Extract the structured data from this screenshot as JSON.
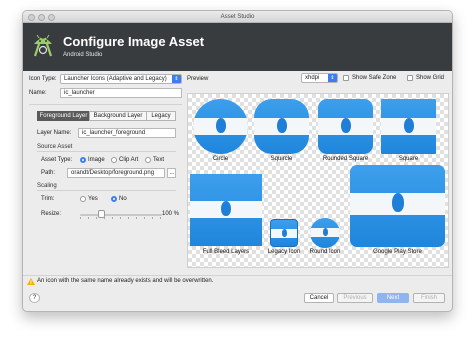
{
  "window": {
    "title": "Asset Studio"
  },
  "header": {
    "title": "Configure Image Asset",
    "subtitle": "Android Studio"
  },
  "form": {
    "icon_type_label": "Icon Type:",
    "icon_type_value": "Launcher Icons (Adaptive and Legacy)",
    "name_label": "Name:",
    "name_value": "ic_launcher",
    "tabs": [
      "Foreground Layer",
      "Background Layer",
      "Legacy"
    ],
    "active_tab": "Foreground Layer",
    "layer_name_label": "Layer Name:",
    "layer_name_value": "ic_launcher_foreground",
    "source_asset_title": "Source Asset",
    "asset_type_label": "Asset Type:",
    "asset_type_options": [
      "Image",
      "Clip Art",
      "Text"
    ],
    "asset_type_selected": "Image",
    "path_label": "Path:",
    "path_value": "orandt/Desktop/foreground.png",
    "path_browse": "...",
    "scaling_title": "Scaling",
    "trim_label": "Trim:",
    "trim_options": [
      "Yes",
      "No"
    ],
    "trim_selected": "No",
    "resize_label": "Resize:",
    "resize_value": "100 %",
    "resize_percent": 100
  },
  "preview": {
    "label": "Preview",
    "density": "xhdpi",
    "show_safe_zone_label": "Show Safe Zone",
    "show_safe_zone": false,
    "show_grid_label": "Show Grid",
    "show_grid": false,
    "icons": [
      "Circle",
      "Squircle",
      "Rounded Square",
      "Square",
      "Full Bleed Layers",
      "Legacy Icon",
      "Round Icon",
      "Google Play Store"
    ]
  },
  "warning": {
    "icon": "warning-icon",
    "text": "An icon with the same name already exists and will be overwritten."
  },
  "buttons": {
    "help": "?",
    "cancel": "Cancel",
    "previous": "Previous",
    "next": "Next",
    "finish": "Finish"
  },
  "colors": {
    "header_bg": "#383c3f",
    "accent": "#3a7ff0",
    "icon_blue": "#2b8fe5",
    "warning": "#f0b400"
  }
}
